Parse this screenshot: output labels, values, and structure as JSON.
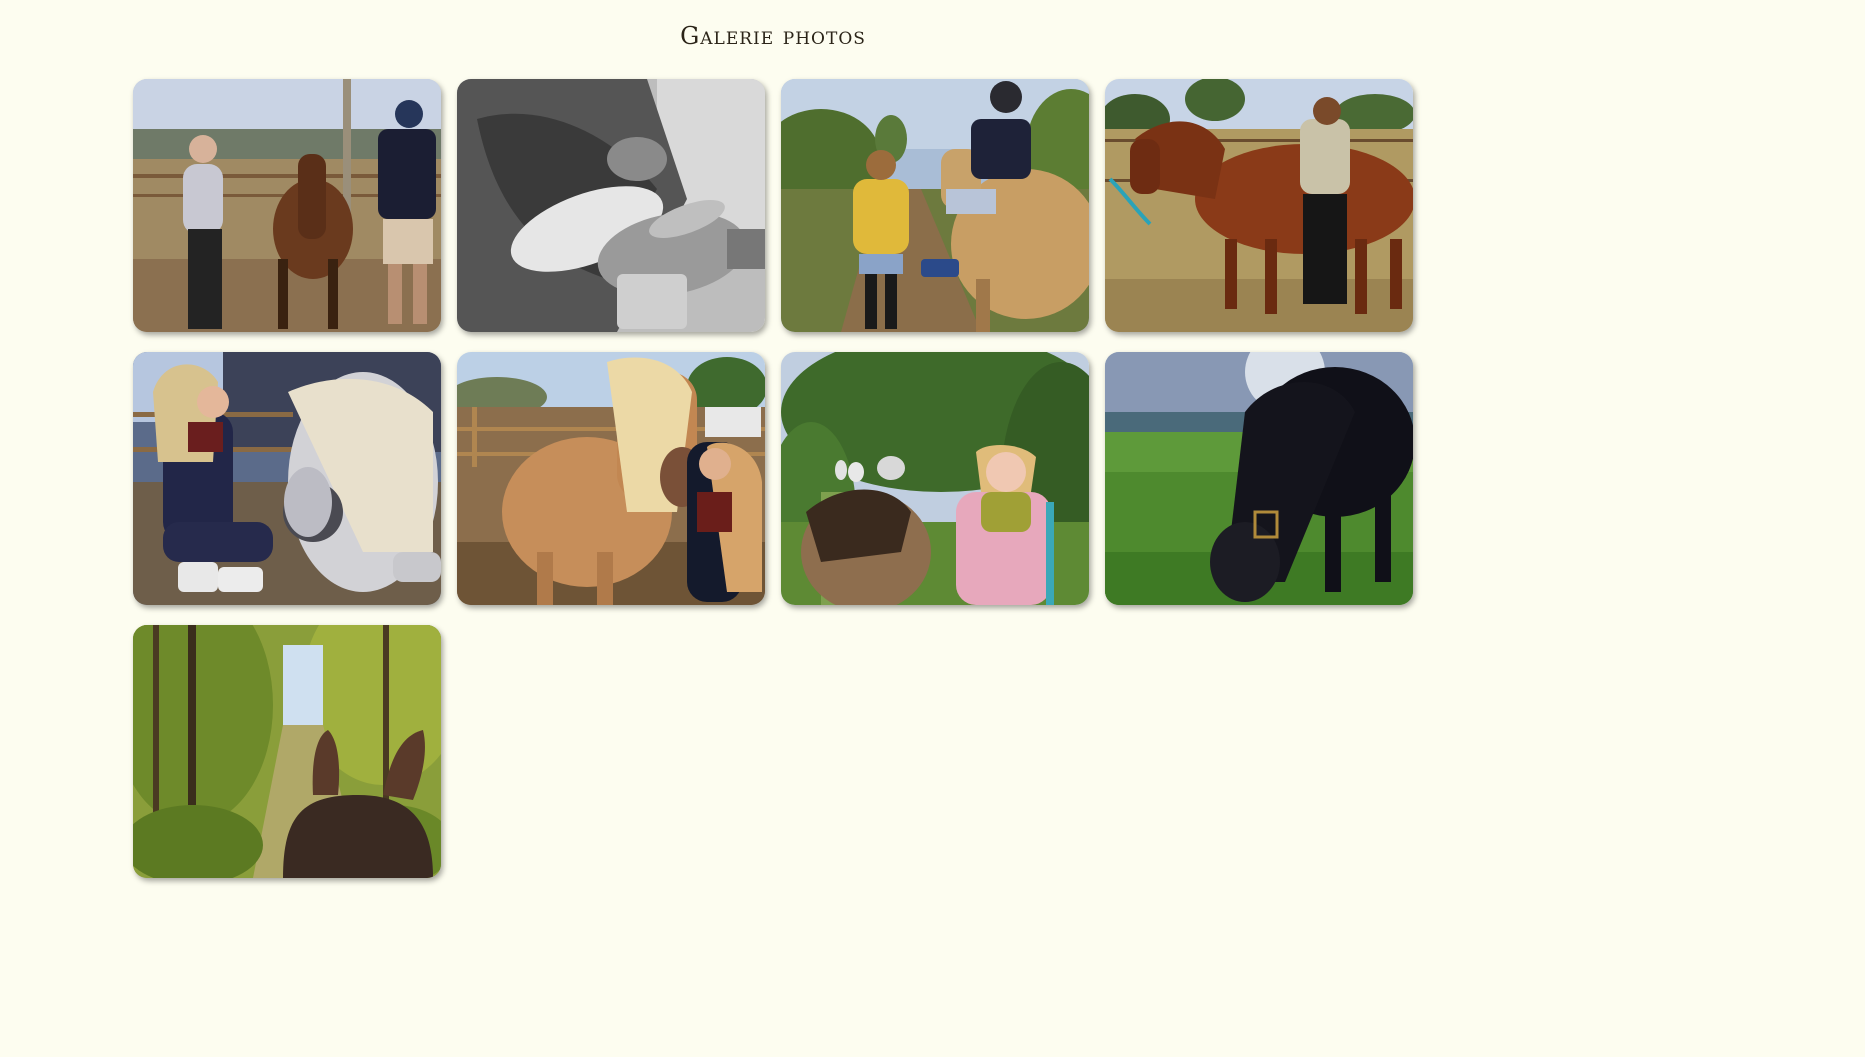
{
  "page": {
    "title": "Galerie photos",
    "background": "#fdfdf0"
  },
  "gallery": {
    "photos": [
      {
        "name": "photo-two-riders-leading-bay-horse",
        "tone": "color"
      },
      {
        "name": "photo-hands-grooming-black-white",
        "tone": "grayscale"
      },
      {
        "name": "photo-child-on-palomino-pony-with-girl",
        "tone": "color"
      },
      {
        "name": "photo-woman-with-chestnut-horse",
        "tone": "color"
      },
      {
        "name": "photo-woman-kneeling-with-grey-horse",
        "tone": "color"
      },
      {
        "name": "photo-woman-with-haflinger-horse",
        "tone": "color"
      },
      {
        "name": "photo-girl-with-pony-on-trail",
        "tone": "color"
      },
      {
        "name": "photo-black-horse-grazing",
        "tone": "color"
      },
      {
        "name": "photo-forest-trail-between-horse-ears",
        "tone": "color"
      }
    ]
  }
}
